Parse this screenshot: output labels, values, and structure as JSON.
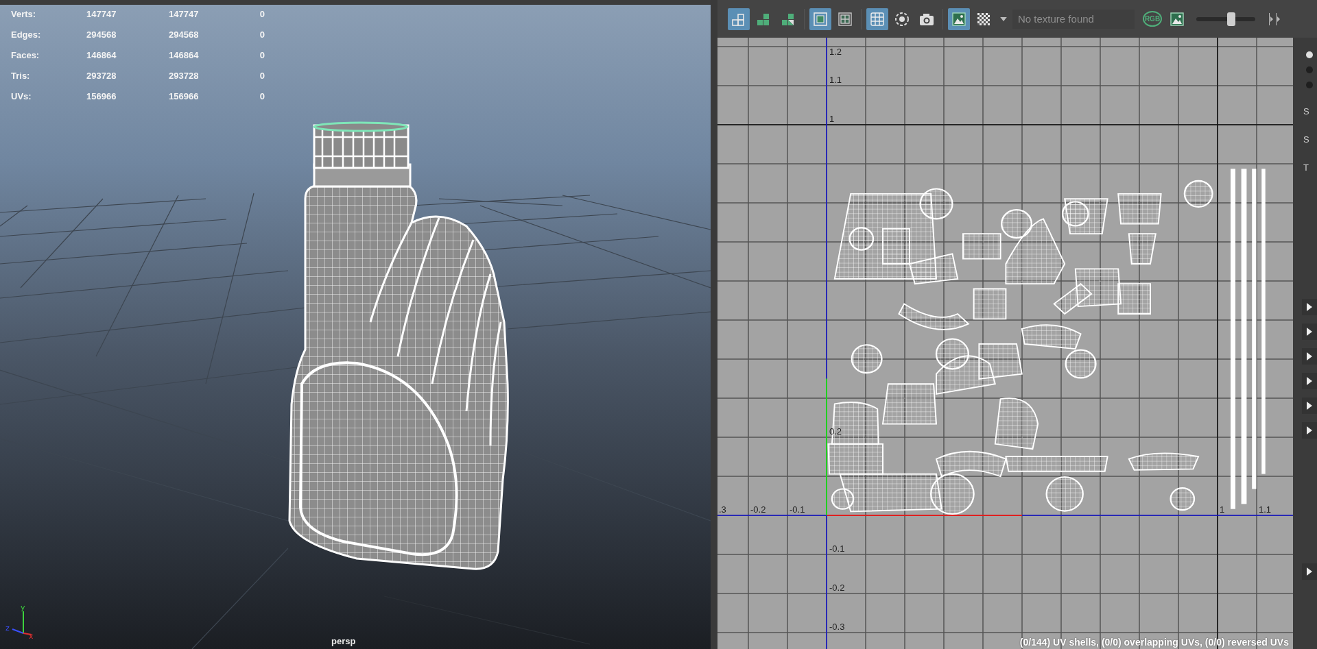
{
  "viewport": {
    "hud": [
      {
        "label": "Verts:",
        "values": [
          "147747",
          "147747",
          "0"
        ]
      },
      {
        "label": "Edges:",
        "values": [
          "294568",
          "294568",
          "0"
        ]
      },
      {
        "label": "Faces:",
        "values": [
          "146864",
          "146864",
          "0"
        ]
      },
      {
        "label": "Tris:",
        "values": [
          "293728",
          "293728",
          "0"
        ]
      },
      {
        "label": "UVs:",
        "values": [
          "156966",
          "156966",
          "0"
        ]
      }
    ],
    "axis_labels": [
      "y",
      "z",
      "x"
    ],
    "camera": "persp"
  },
  "uv_editor": {
    "toolbar": [
      {
        "kind": "stack",
        "selected": true
      },
      {
        "kind": "stack-green",
        "selected": false
      },
      {
        "kind": "stack-half",
        "selected": false
      },
      {
        "kind": "separator"
      },
      {
        "kind": "frame",
        "selected": true
      },
      {
        "kind": "frame-grid",
        "selected": false
      },
      {
        "kind": "separator"
      },
      {
        "kind": "grid",
        "selected": true
      },
      {
        "kind": "dashed-circle",
        "selected": false
      },
      {
        "kind": "camera",
        "selected": false
      },
      {
        "kind": "separator"
      },
      {
        "kind": "image",
        "selected": true
      },
      {
        "kind": "checker",
        "selected": false
      },
      {
        "kind": "caret",
        "selected": false
      },
      {
        "kind": "field",
        "value": "No texture found"
      },
      {
        "kind": "rgb",
        "label": "RGB",
        "selected": false
      },
      {
        "kind": "image-green",
        "selected": false
      },
      {
        "kind": "slider",
        "level": 0.62
      },
      {
        "kind": "arrows",
        "selected": false
      }
    ],
    "u_labels": [
      ".3",
      "-0.2",
      "-0.1",
      "1",
      "1.1"
    ],
    "v_labels": [
      "1.2",
      "1.1",
      "1",
      "0.2",
      "-0.1",
      "-0.2",
      "-0.3"
    ],
    "status": "(0/144) UV shells, (0/0) overlapping UVs, (0/0) reversed UVs"
  },
  "side_panel": {
    "radios": [
      {
        "selected": true
      },
      {
        "selected": false
      },
      {
        "selected": false
      }
    ],
    "labels": [
      "S",
      "S",
      "T"
    ]
  }
}
